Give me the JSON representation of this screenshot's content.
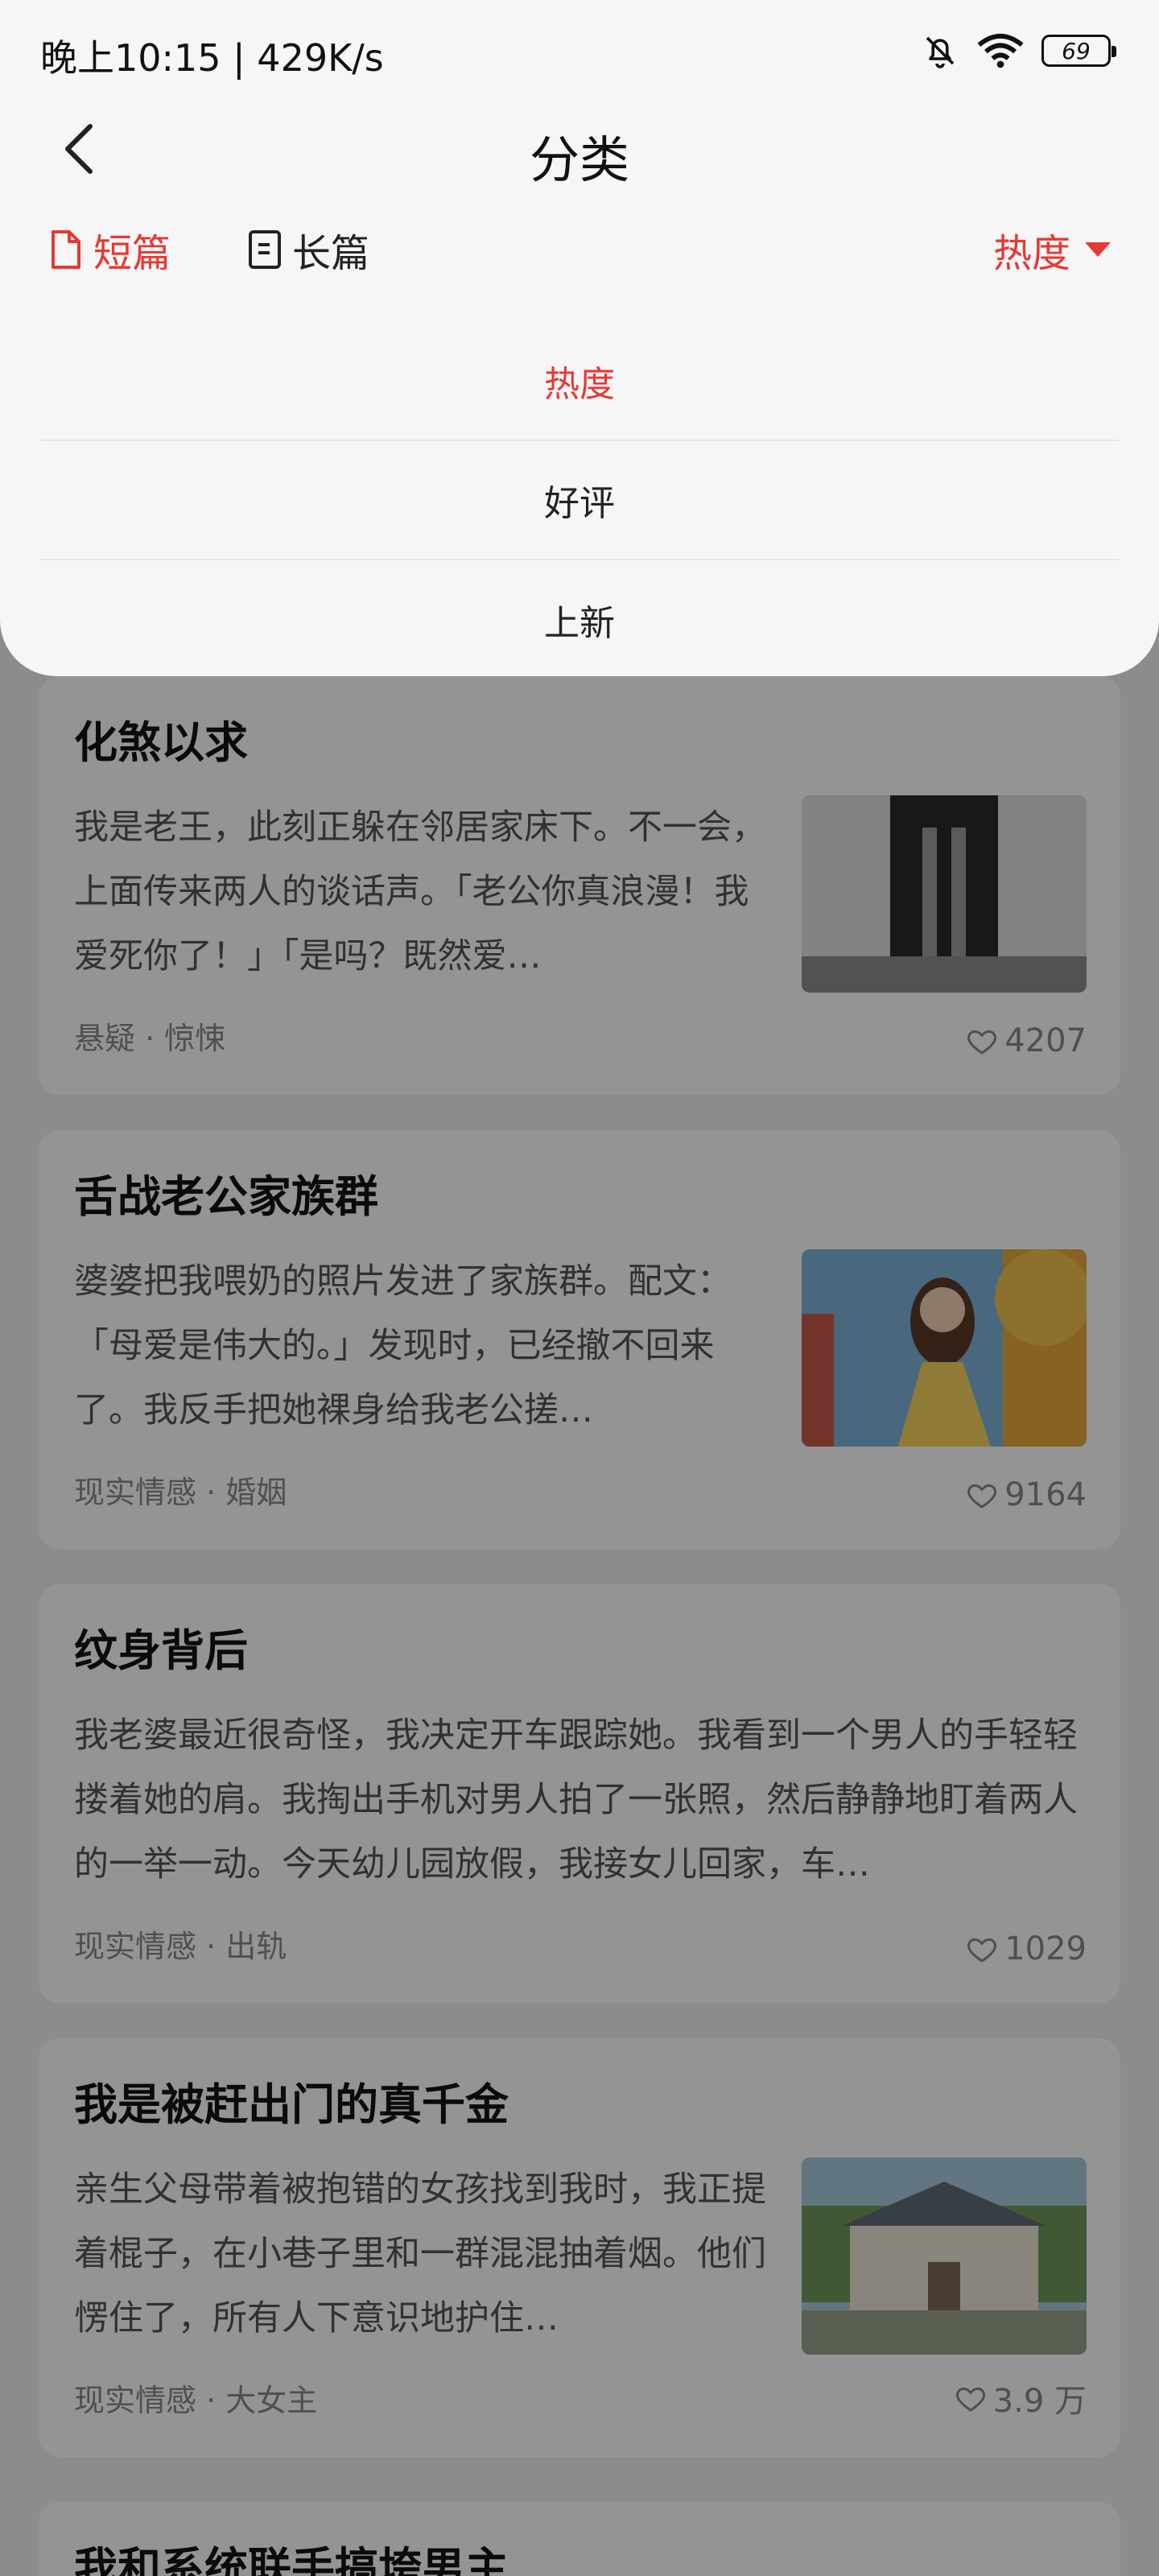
{
  "status_bar": {
    "time": "晚上10:15 | 429K/s",
    "battery": "69",
    "icons": [
      "bell-muted-icon",
      "wifi-icon",
      "battery-icon"
    ]
  },
  "nav": {
    "title": "分类",
    "back_icon": "chevron-left-icon"
  },
  "tabs": {
    "short": "短篇",
    "long": "长篇"
  },
  "sort": {
    "current": "热度",
    "options": [
      "热度",
      "好评",
      "上新"
    ]
  },
  "colors": {
    "accent": "#e53935",
    "panel_bg": "#f6f6f6",
    "card_bg": "#ffffff"
  },
  "stories": [
    {
      "title": "化煞以求",
      "desc": "我是老王，此刻正躲在邻居家床下。不一会，上面传来两人的谈话声。「老公你真浪漫！我爱死你了！」「是吗？既然爱…",
      "tags": "悬疑 · 惊悚",
      "likes": "4207",
      "thumb": "curtain-feet-illustration"
    },
    {
      "title": "舌战老公家族群",
      "desc": "婆婆把我喂奶的照片发进了家族群。配文：「母爱是伟大的。」发现时，已经撤不回来了。我反手把她裸身给我老公搓…",
      "tags": "现实情感 · 婚姻",
      "likes": "9164",
      "thumb": "girl-yellow-dress-illustration"
    },
    {
      "title": "纹身背后",
      "desc": "我老婆最近很奇怪，我决定开车跟踪她。我看到一个男人的手轻轻搂着她的肩。我掏出手机对男人拍了一张照，然后静静地盯着两人的一举一动。今天幼儿园放假，我接女儿回家，车…",
      "tags": "现实情感 · 出轨",
      "likes": "1029"
    },
    {
      "title": "我是被赶出门的真千金",
      "desc": "亲生父母带着被抱错的女孩找到我时，我正提着棍子，在小巷子里和一群混混抽着烟。他们愣住了，所有人下意识地护住…",
      "tags": "现实情感 · 大女主",
      "likes": "3.9 万",
      "thumb": "mansion-illustration"
    },
    {
      "title": "我和系统联手搞垮男主"
    }
  ]
}
